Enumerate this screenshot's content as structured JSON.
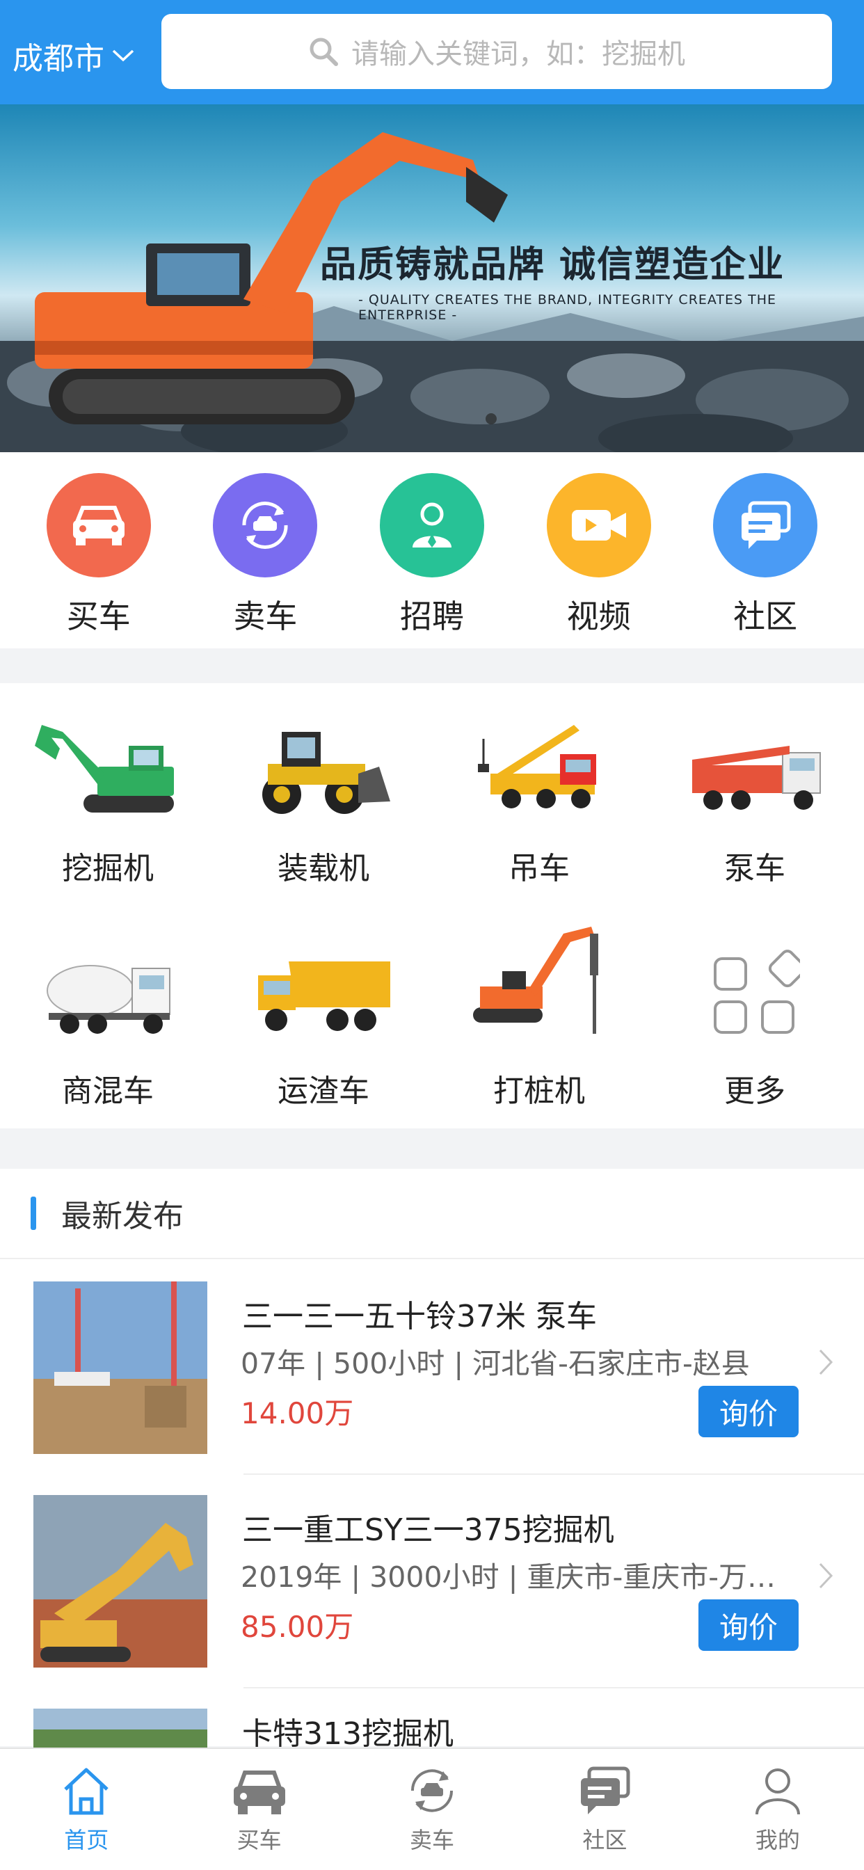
{
  "header": {
    "city": "成都市",
    "search_placeholder": "请输入关键词，如：挖掘机"
  },
  "banner": {
    "slogan": "品质铸就品牌  诚信塑造企业",
    "subtitle": "- QUALITY CREATES THE BRAND, INTEGRITY CREATES THE ENTERPRISE -"
  },
  "quick_nav": [
    {
      "label": "买车",
      "icon": "car-icon",
      "color": "#f2694e"
    },
    {
      "label": "卖车",
      "icon": "car-exchange-icon",
      "color": "#7a6cf0"
    },
    {
      "label": "招聘",
      "icon": "person-icon",
      "color": "#27c296"
    },
    {
      "label": "视频",
      "icon": "video-icon",
      "color": "#fcb52b"
    },
    {
      "label": "社区",
      "icon": "chat-icon",
      "color": "#4a9bf5"
    }
  ],
  "categories": [
    {
      "label": "挖掘机",
      "icon": "excavator-icon"
    },
    {
      "label": "装载机",
      "icon": "loader-icon"
    },
    {
      "label": "吊车",
      "icon": "crane-truck-icon"
    },
    {
      "label": "泵车",
      "icon": "pump-truck-icon"
    },
    {
      "label": "商混车",
      "icon": "mixer-truck-icon"
    },
    {
      "label": "运渣车",
      "icon": "dump-truck-icon"
    },
    {
      "label": "打桩机",
      "icon": "pile-driver-icon"
    },
    {
      "label": "更多",
      "icon": "more-grid-icon"
    }
  ],
  "latest": {
    "title": "最新发布",
    "items": [
      {
        "title": "三一三一五十铃37米 泵车",
        "meta": "07年 | 500小时 | 河北省-石家庄市-赵县",
        "price": "14.00万",
        "button": "询价"
      },
      {
        "title": "三一重工SY三一375挖掘机",
        "meta": "2019年 | 3000小时 | 重庆市-重庆市-万…",
        "price": "85.00万",
        "button": "询价"
      },
      {
        "title": "卡特313挖掘机",
        "meta": "",
        "price": "",
        "button": ""
      }
    ]
  },
  "tabbar": [
    {
      "label": "首页",
      "icon": "home-icon",
      "active": true
    },
    {
      "label": "买车",
      "icon": "car-icon",
      "active": false
    },
    {
      "label": "卖车",
      "icon": "car-exchange-icon",
      "active": false
    },
    {
      "label": "社区",
      "icon": "chat-icon",
      "active": false
    },
    {
      "label": "我的",
      "icon": "profile-icon",
      "active": false
    }
  ],
  "colors": {
    "brand": "#2a95ee",
    "price": "#e0463c",
    "button": "#1f86e6"
  }
}
